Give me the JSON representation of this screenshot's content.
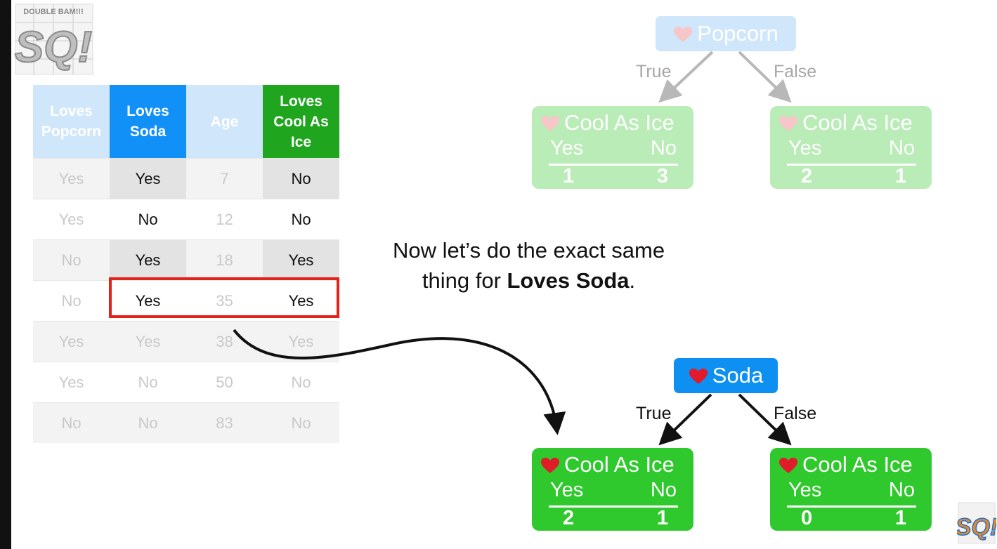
{
  "logo_text": "SQ!",
  "logo_tagline": "DOUBLE BAM!!!",
  "table": {
    "headers": [
      "Loves Popcorn",
      "Loves Soda",
      "Age",
      "Loves Cool As Ice"
    ],
    "rows": [
      [
        "Yes",
        "Yes",
        "7",
        "No"
      ],
      [
        "Yes",
        "No",
        "12",
        "No"
      ],
      [
        "No",
        "Yes",
        "18",
        "Yes"
      ],
      [
        "No",
        "Yes",
        "35",
        "Yes"
      ],
      [
        "Yes",
        "Yes",
        "38",
        "Yes"
      ],
      [
        "Yes",
        "No",
        "50",
        "No"
      ],
      [
        "No",
        "No",
        "83",
        "No"
      ]
    ],
    "highlighted_row": 4
  },
  "caption": {
    "part1": "Now let’s do the exact same thing for ",
    "bold": "Loves Soda",
    "part2": "."
  },
  "tree_popcorn": {
    "root": "Popcorn",
    "true_label": "True",
    "false_label": "False",
    "left": {
      "title": "Cool As Ice",
      "yes_label": "Yes",
      "no_label": "No",
      "yes": "1",
      "no": "3"
    },
    "right": {
      "title": "Cool As Ice",
      "yes_label": "Yes",
      "no_label": "No",
      "yes": "2",
      "no": "1"
    }
  },
  "tree_soda": {
    "root": "Soda",
    "true_label": "True",
    "false_label": "False",
    "left": {
      "title": "Cool As Ice",
      "yes_label": "Yes",
      "no_label": "No",
      "yes": "2",
      "no": "1"
    },
    "right": {
      "title": "Cool As Ice",
      "yes_label": "Yes",
      "no_label": "No",
      "yes": "0",
      "no": "1"
    }
  },
  "colors": {
    "soda_header": "#1190f7",
    "target_header": "#20a51f",
    "leaf_active": "#2fc92d",
    "highlight": "#e2231a",
    "heart": "#e21b2a"
  }
}
